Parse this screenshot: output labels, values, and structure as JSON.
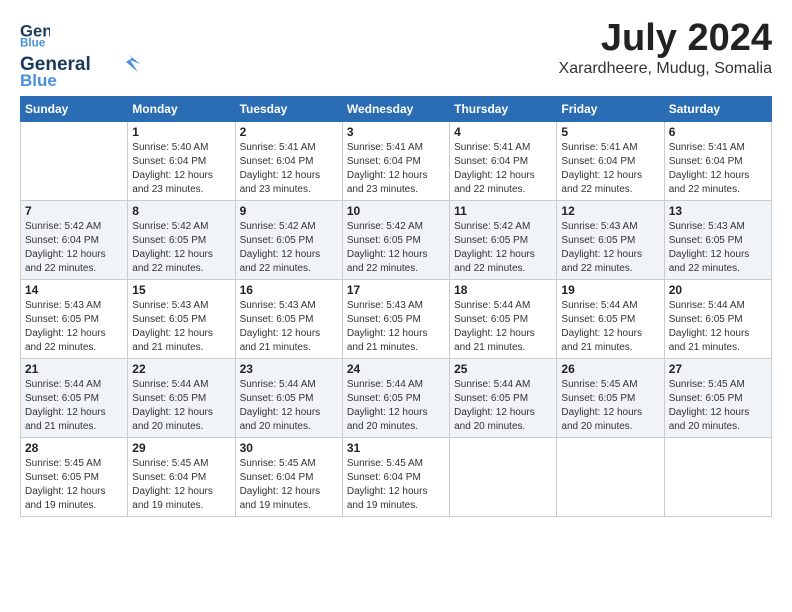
{
  "header": {
    "logo_line1": "General",
    "logo_line2": "Blue",
    "month": "July 2024",
    "location": "Xarardheere, Mudug, Somalia"
  },
  "weekdays": [
    "Sunday",
    "Monday",
    "Tuesday",
    "Wednesday",
    "Thursday",
    "Friday",
    "Saturday"
  ],
  "weeks": [
    [
      {
        "day": "",
        "info": ""
      },
      {
        "day": "1",
        "info": "Sunrise: 5:40 AM\nSunset: 6:04 PM\nDaylight: 12 hours\nand 23 minutes."
      },
      {
        "day": "2",
        "info": "Sunrise: 5:41 AM\nSunset: 6:04 PM\nDaylight: 12 hours\nand 23 minutes."
      },
      {
        "day": "3",
        "info": "Sunrise: 5:41 AM\nSunset: 6:04 PM\nDaylight: 12 hours\nand 23 minutes."
      },
      {
        "day": "4",
        "info": "Sunrise: 5:41 AM\nSunset: 6:04 PM\nDaylight: 12 hours\nand 22 minutes."
      },
      {
        "day": "5",
        "info": "Sunrise: 5:41 AM\nSunset: 6:04 PM\nDaylight: 12 hours\nand 22 minutes."
      },
      {
        "day": "6",
        "info": "Sunrise: 5:41 AM\nSunset: 6:04 PM\nDaylight: 12 hours\nand 22 minutes."
      }
    ],
    [
      {
        "day": "7",
        "info": "Sunrise: 5:42 AM\nSunset: 6:04 PM\nDaylight: 12 hours\nand 22 minutes."
      },
      {
        "day": "8",
        "info": "Sunrise: 5:42 AM\nSunset: 6:05 PM\nDaylight: 12 hours\nand 22 minutes."
      },
      {
        "day": "9",
        "info": "Sunrise: 5:42 AM\nSunset: 6:05 PM\nDaylight: 12 hours\nand 22 minutes."
      },
      {
        "day": "10",
        "info": "Sunrise: 5:42 AM\nSunset: 6:05 PM\nDaylight: 12 hours\nand 22 minutes."
      },
      {
        "day": "11",
        "info": "Sunrise: 5:42 AM\nSunset: 6:05 PM\nDaylight: 12 hours\nand 22 minutes."
      },
      {
        "day": "12",
        "info": "Sunrise: 5:43 AM\nSunset: 6:05 PM\nDaylight: 12 hours\nand 22 minutes."
      },
      {
        "day": "13",
        "info": "Sunrise: 5:43 AM\nSunset: 6:05 PM\nDaylight: 12 hours\nand 22 minutes."
      }
    ],
    [
      {
        "day": "14",
        "info": "Sunrise: 5:43 AM\nSunset: 6:05 PM\nDaylight: 12 hours\nand 22 minutes."
      },
      {
        "day": "15",
        "info": "Sunrise: 5:43 AM\nSunset: 6:05 PM\nDaylight: 12 hours\nand 21 minutes."
      },
      {
        "day": "16",
        "info": "Sunrise: 5:43 AM\nSunset: 6:05 PM\nDaylight: 12 hours\nand 21 minutes."
      },
      {
        "day": "17",
        "info": "Sunrise: 5:43 AM\nSunset: 6:05 PM\nDaylight: 12 hours\nand 21 minutes."
      },
      {
        "day": "18",
        "info": "Sunrise: 5:44 AM\nSunset: 6:05 PM\nDaylight: 12 hours\nand 21 minutes."
      },
      {
        "day": "19",
        "info": "Sunrise: 5:44 AM\nSunset: 6:05 PM\nDaylight: 12 hours\nand 21 minutes."
      },
      {
        "day": "20",
        "info": "Sunrise: 5:44 AM\nSunset: 6:05 PM\nDaylight: 12 hours\nand 21 minutes."
      }
    ],
    [
      {
        "day": "21",
        "info": "Sunrise: 5:44 AM\nSunset: 6:05 PM\nDaylight: 12 hours\nand 21 minutes."
      },
      {
        "day": "22",
        "info": "Sunrise: 5:44 AM\nSunset: 6:05 PM\nDaylight: 12 hours\nand 20 minutes."
      },
      {
        "day": "23",
        "info": "Sunrise: 5:44 AM\nSunset: 6:05 PM\nDaylight: 12 hours\nand 20 minutes."
      },
      {
        "day": "24",
        "info": "Sunrise: 5:44 AM\nSunset: 6:05 PM\nDaylight: 12 hours\nand 20 minutes."
      },
      {
        "day": "25",
        "info": "Sunrise: 5:44 AM\nSunset: 6:05 PM\nDaylight: 12 hours\nand 20 minutes."
      },
      {
        "day": "26",
        "info": "Sunrise: 5:45 AM\nSunset: 6:05 PM\nDaylight: 12 hours\nand 20 minutes."
      },
      {
        "day": "27",
        "info": "Sunrise: 5:45 AM\nSunset: 6:05 PM\nDaylight: 12 hours\nand 20 minutes."
      }
    ],
    [
      {
        "day": "28",
        "info": "Sunrise: 5:45 AM\nSunset: 6:05 PM\nDaylight: 12 hours\nand 19 minutes."
      },
      {
        "day": "29",
        "info": "Sunrise: 5:45 AM\nSunset: 6:04 PM\nDaylight: 12 hours\nand 19 minutes."
      },
      {
        "day": "30",
        "info": "Sunrise: 5:45 AM\nSunset: 6:04 PM\nDaylight: 12 hours\nand 19 minutes."
      },
      {
        "day": "31",
        "info": "Sunrise: 5:45 AM\nSunset: 6:04 PM\nDaylight: 12 hours\nand 19 minutes."
      },
      {
        "day": "",
        "info": ""
      },
      {
        "day": "",
        "info": ""
      },
      {
        "day": "",
        "info": ""
      }
    ]
  ]
}
